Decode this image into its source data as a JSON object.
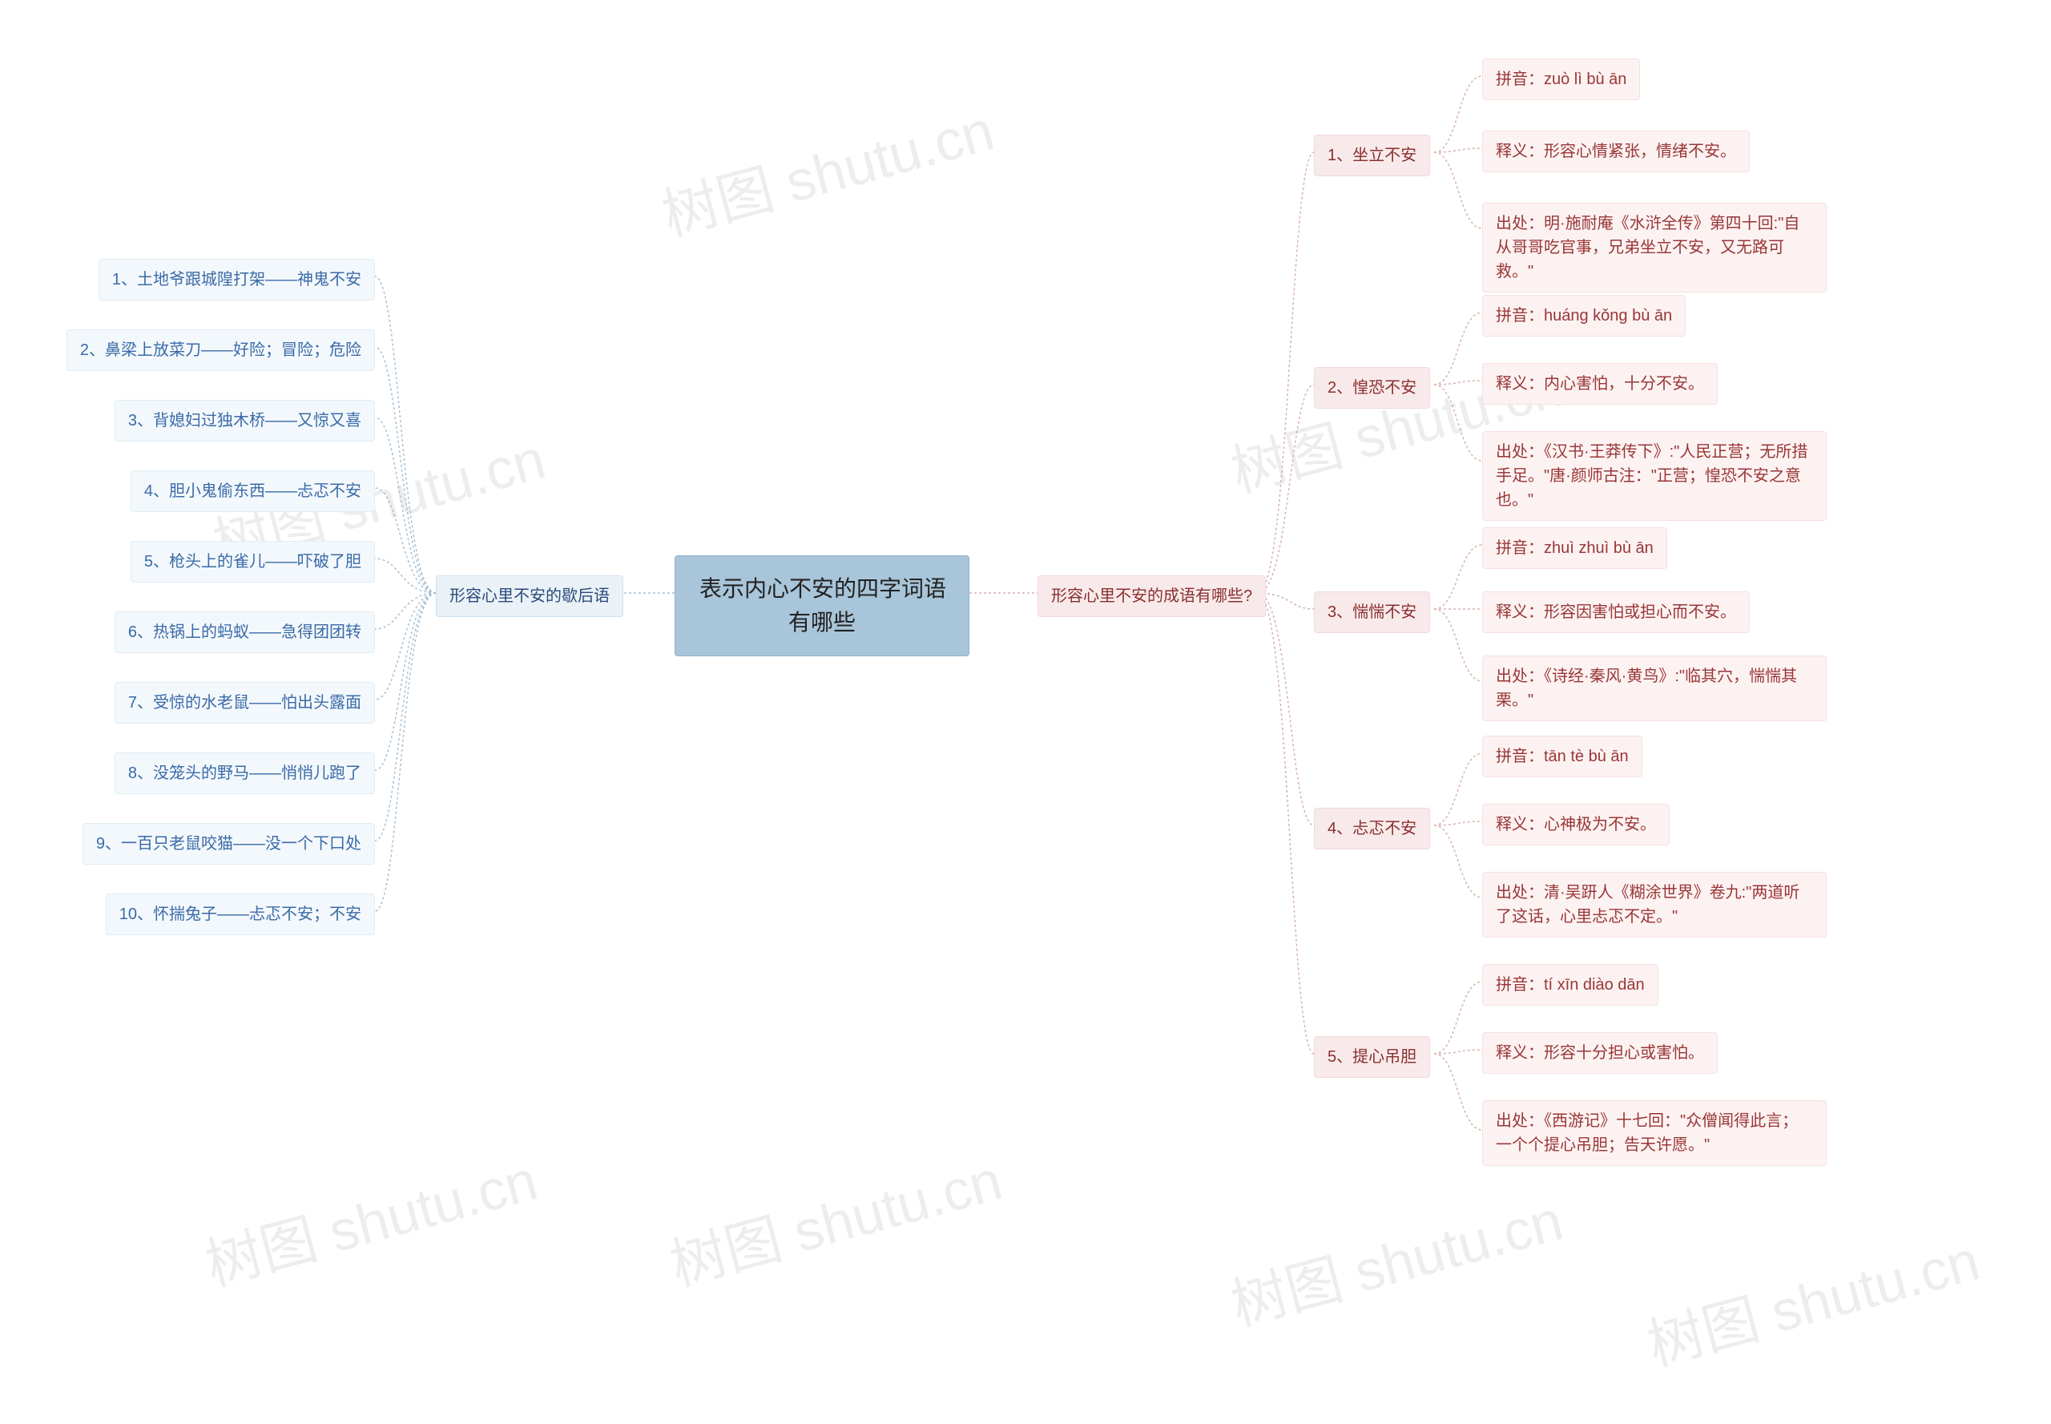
{
  "watermark": "树图 shutu.cn",
  "root": "表示内心不安的四字词语\n有哪些",
  "left": {
    "title": "形容心里不安的歇后语",
    "items": [
      "1、土地爷跟城隍打架——神鬼不安",
      "2、鼻梁上放菜刀——好险；冒险；危险",
      "3、背媳妇过独木桥——又惊又喜",
      "4、胆小鬼偷东西——忐忑不安",
      "5、枪头上的雀儿——吓破了胆",
      "6、热锅上的蚂蚁——急得团团转",
      "7、受惊的水老鼠——怕出头露面",
      "8、没笼头的野马——悄悄儿跑了",
      "9、一百只老鼠咬猫——没一个下口处",
      "10、怀揣兔子——忐忑不安；不安"
    ]
  },
  "right": {
    "title": "形容心里不安的成语有哪些?",
    "idioms": [
      {
        "name": "1、坐立不安",
        "pinyin": "拼音：zuò lì bù ān",
        "meaning": "释义：形容心情紧张，情绪不安。",
        "source": "出处：明·施耐庵《水浒全传》第四十回:\"自从哥哥吃官事，兄弟坐立不安，又无路可救。\""
      },
      {
        "name": "2、惶恐不安",
        "pinyin": "拼音：huáng kǒng bù ān",
        "meaning": "释义：内心害怕，十分不安。",
        "source": "出处：《汉书·王莽传下》:\"人民正营；无所措手足。\"唐·颜师古注：\"正营；惶恐不安之意也。\""
      },
      {
        "name": "3、惴惴不安",
        "pinyin": "拼音：zhuì zhuì bù ān",
        "meaning": "释义：形容因害怕或担心而不安。",
        "source": "出处：《诗经·秦风·黄鸟》:\"临其穴，惴惴其栗。\""
      },
      {
        "name": "4、忐忑不安",
        "pinyin": "拼音：tān tè bù ān",
        "meaning": "释义：心神极为不安。",
        "source": "出处：清·吴趼人《糊涂世界》卷九:\"两道听了这话，心里忐忑不定。\""
      },
      {
        "name": "5、提心吊胆",
        "pinyin": "拼音：tí xīn diào dān",
        "meaning": "释义：形容十分担心或害怕。",
        "source": "出处：《西游记》十七回：\"众僧闻得此言；一个个提心吊胆；告天许愿。\""
      }
    ]
  }
}
